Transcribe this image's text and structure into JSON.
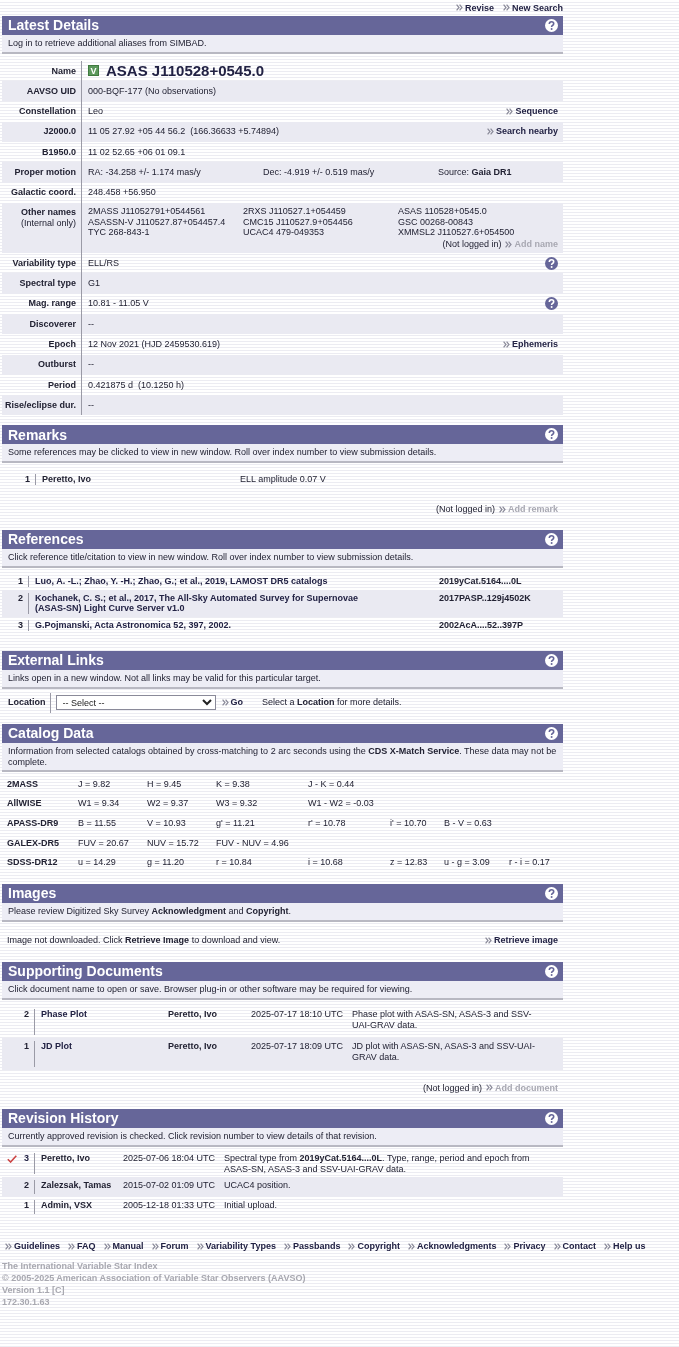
{
  "top_links": [
    {
      "label": "Revise",
      "disabled": false
    },
    {
      "label": "New Search",
      "disabled": false
    }
  ],
  "latest_details": {
    "title": "Latest Details",
    "note": "Log in to retrieve additional aliases from SIMBAD.",
    "rows": [
      {
        "label": "Name",
        "kind": "name",
        "badge": "V",
        "value": "ASAS J110528+0545.0",
        "help": false
      },
      {
        "label": "AAVSO UID",
        "kind": "text",
        "value": "000-BQF-177 (No observations)",
        "help": false
      },
      {
        "label": "Constellation",
        "kind": "text",
        "value": "Leo",
        "link": {
          "label": "Sequence",
          "disabled": false
        },
        "help": false
      },
      {
        "label": "J2000.0",
        "kind": "text",
        "value": "11 05 27.92 +05 44 56.2  (166.36633 +5.74894)",
        "link": {
          "label": "Search nearby",
          "disabled": false
        },
        "help": false
      },
      {
        "label": "B1950.0",
        "kind": "text",
        "value": "11 02 52.65 +06 01 09.1",
        "help": false
      },
      {
        "label": "Proper motion",
        "kind": "columns",
        "cells": [
          "RA: -34.258 +/- 1.174 mas/y",
          "Dec: -4.919 +/- 0.519 mas/y",
          "Source: **Gaia DR1**"
        ],
        "help": false
      },
      {
        "label": "Galactic coord.",
        "kind": "text",
        "value": "248.458 +56.950",
        "help": false
      },
      {
        "label": "Other names",
        "sublabel": "(Internal only)",
        "kind": "names",
        "names": [
          "2MASS J11052791+0544561",
          "2RXS J110527.1+054459",
          "ASAS 110528+0545.0",
          "ASASSN-V J110527.87+054457.4",
          "CMC15 J110527.9+054456",
          "GSC 00268-00843",
          "TYC 268-843-1",
          "UCAC4 479-049353",
          "XMMSL2 J110527.6+054500"
        ],
        "note": "(Not logged in)",
        "link": {
          "label": "Add name",
          "disabled": true
        },
        "help": false
      },
      {
        "label": "Variability type",
        "kind": "text",
        "value": "ELL/RS",
        "help": true
      },
      {
        "label": "Spectral type",
        "kind": "text",
        "value": "G1",
        "help": false
      },
      {
        "label": "Mag. range",
        "kind": "text",
        "value": "10.81 - 11.05 V",
        "help": true
      },
      {
        "label": "Discoverer",
        "kind": "text",
        "value": "--",
        "help": false
      },
      {
        "label": "Epoch",
        "kind": "text",
        "value": "12 Nov 2021 (HJD 2459530.619)",
        "link": {
          "label": "Ephemeris",
          "disabled": false
        },
        "help": false
      },
      {
        "label": "Outburst",
        "kind": "text",
        "value": "--",
        "help": false
      },
      {
        "label": "Period",
        "kind": "text",
        "value": "0.421875 d  (10.1250 h)",
        "help": false
      },
      {
        "label": "Rise/eclipse dur.",
        "kind": "text",
        "value": "--",
        "help": false
      }
    ]
  },
  "remarks": {
    "title": "Remarks",
    "note": "Some references may be clicked to view in new window. Roll over index number to view submission details.",
    "rows": [
      {
        "index": "1",
        "author": "Peretto, Ivo",
        "text": "ELL amplitude 0.07 V"
      }
    ],
    "footer_note": "(Not logged in)",
    "footer_link": {
      "label": "Add remark",
      "disabled": true
    }
  },
  "references": {
    "title": "References",
    "note": "Click reference title/citation to view in new window. Roll over index number to view submission details.",
    "rows": [
      {
        "index": "1",
        "citation": "Luo, A. -L.; Zhao, Y. -H.; Zhao, G.; et al., 2019, LAMOST DR5 catalogs",
        "code": "2019yCat.5164....0L"
      },
      {
        "index": "2",
        "citation": "Kochanek, C. S.; et al., 2017, The All-Sky Automated Survey for Supernovae (ASAS-SN) Light Curve Server v1.0",
        "code": "2017PASP..129j4502K"
      },
      {
        "index": "3",
        "citation": "G.Pojmanski, Acta Astronomica 52, 397, 2002.",
        "code": "2002AcA....52..397P"
      }
    ]
  },
  "external_links": {
    "title": "External Links",
    "note": "Links open in a new window. Not all links may be valid for this particular target.",
    "location_label": "Location",
    "select_value": "-- Select --",
    "go_link": {
      "label": "Go",
      "disabled": false
    },
    "hint": "Select a **Location** for more details."
  },
  "catalog_data": {
    "title": "Catalog Data",
    "note": "Information from selected catalogs obtained by cross-matching to 2 arc seconds using the **CDS X-Match Service**. These data may not be complete.",
    "rows": [
      {
        "catalog": "2MASS",
        "values": [
          "J = 9.82",
          "H = 9.45",
          "K = 9.38",
          "J - K = 0.44"
        ]
      },
      {
        "catalog": "AllWISE",
        "values": [
          "W1 = 9.34",
          "W2 = 9.37",
          "W3 = 9.32",
          "W1 - W2 = -0.03"
        ]
      },
      {
        "catalog": "APASS-DR9",
        "values": [
          "B = 11.55",
          "V = 10.93",
          "g' = 11.21",
          "r' = 10.78",
          "i' = 10.70",
          "B - V = 0.63"
        ]
      },
      {
        "catalog": "GALEX-DR5",
        "values": [
          "FUV = 20.67",
          "NUV = 15.72",
          "FUV - NUV = 4.96"
        ]
      },
      {
        "catalog": "SDSS-DR12",
        "values": [
          "u = 14.29",
          "g = 11.20",
          "r = 10.84",
          "i = 10.68",
          "z = 12.83",
          "u - g = 3.09",
          "r - i = 0.17"
        ]
      }
    ]
  },
  "images": {
    "title": "Images",
    "note": "Please review Digitized Sky Survey **Acknowledgment** and **Copyright**.",
    "text": "Image not downloaded. Click **Retrieve Image** to download and view.",
    "link": {
      "label": "Retrieve image",
      "disabled": false
    }
  },
  "supporting_documents": {
    "title": "Supporting Documents",
    "note": "Click document name to open or save. Browser plug-in or other software may be required for viewing.",
    "rows": [
      {
        "index": "2",
        "name": "Phase Plot",
        "author": "Peretto, Ivo",
        "date": "2025-07-17 18:10 UTC",
        "description": "Phase plot with ASAS-SN, ASAS-3 and SSV-UAI-GRAV data."
      },
      {
        "index": "1",
        "name": "JD Plot",
        "author": "Peretto, Ivo",
        "date": "2025-07-17 18:09 UTC",
        "description": "JD plot with ASAS-SN, ASAS-3 and SSV-UAI-GRAV data."
      }
    ],
    "footer_note": "(Not logged in)",
    "footer_link": {
      "label": "Add document",
      "disabled": true
    }
  },
  "revision_history": {
    "title": "Revision History",
    "note": "Currently approved revision is checked. Click revision number to view details of that revision.",
    "rows": [
      {
        "index": "3",
        "approved": true,
        "author": "Peretto, Ivo",
        "date": "2025-07-06 18:04 UTC",
        "description": "Spectral type from **2019yCat.5164....0L**. Type, range, period and epoch from ASAS-SN, ASAS-3 and SSV-UAI-GRAV data."
      },
      {
        "index": "2",
        "approved": false,
        "author": "Zalezsak, Tamas",
        "date": "2015-07-02 01:09 UTC",
        "description": "UCAC4 position."
      },
      {
        "index": "1",
        "approved": false,
        "author": "Admin, VSX",
        "date": "2005-12-18 01:33 UTC",
        "description": "Initial upload."
      }
    ]
  },
  "footer_links": [
    "Guidelines",
    "FAQ",
    "Manual",
    "Forum",
    "Variability Types",
    "Passbands",
    "Copyright",
    "Acknowledgments",
    "Privacy",
    "Contact",
    "Help us"
  ],
  "footer_lines": [
    "The International Variable Star Index",
    "© 2005-2025 American Association of Variable Star Observers (AAVSO)",
    "Version 1.1 [C]",
    "172.30.1.63"
  ]
}
